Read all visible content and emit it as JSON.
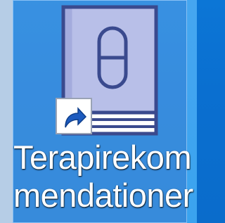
{
  "desktop": {
    "accent": "#0a6fd0",
    "shortcut": {
      "icon": "book-with-pill-icon",
      "overlay": "shortcut-arrow-icon",
      "label_line1": "Terapirekom",
      "label_line2": "mendationer",
      "selected": true
    }
  }
}
